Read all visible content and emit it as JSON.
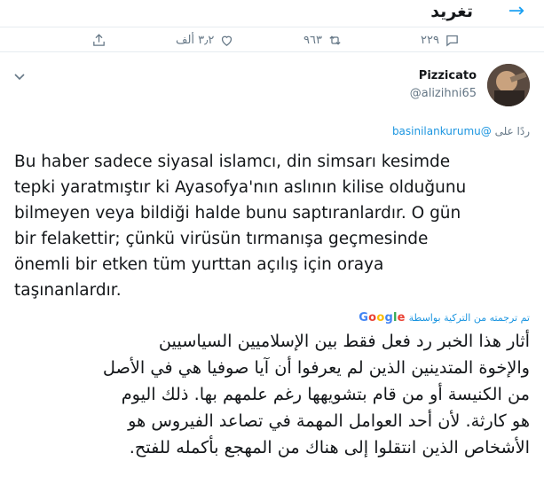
{
  "header": {
    "title": "تغريد",
    "back_icon": "arrow-right-icon"
  },
  "actions": {
    "reply_count": "٢٢٩",
    "retweet_count": "٩٦٣",
    "like_count": "٣٫٢ ألف"
  },
  "author": {
    "name": "Pizzicato",
    "handle": "@alizihni65"
  },
  "reply_to": {
    "prefix": "ردًا على",
    "mention": "@basinilankurumu"
  },
  "tweet": {
    "lines": [
      "Bu haber sadece siyasal islamcı, din simsarı kesimde",
      "tepki yaratmıştır ki Ayasofya'nın aslının kilise olduğunu",
      "bilmeyen veya bildiği halde bunu saptıranlardır. O gün",
      "bir felakettir; çünkü virüsün tırmanışa geçmesinde",
      "önemli bir etken tüm yurttan açılış için oraya",
      "taşınanlardır."
    ]
  },
  "translation": {
    "label": "تم ترجمته من التركية بواسطة",
    "provider": "Google",
    "lines": [
      "أثار هذا الخبر رد فعل فقط بين الإسلاميين السياسيين",
      "والإخوة المتدينين الذين لم يعرفوا أن آيا صوفيا هي في الأصل",
      "من الكنيسة أو من قام بتشويهها رغم علمهم بها. ذلك اليوم",
      "هو كارثة. لأن أحد العوامل المهمة في تصاعد الفيروس هو",
      "الأشخاص الذين انتقلوا إلى هناك من المهجع بأكمله للفتح."
    ]
  },
  "colors": {
    "accent": "#1da1f2",
    "muted": "#657786",
    "text": "#14171a",
    "divider": "#e6ecf0"
  }
}
